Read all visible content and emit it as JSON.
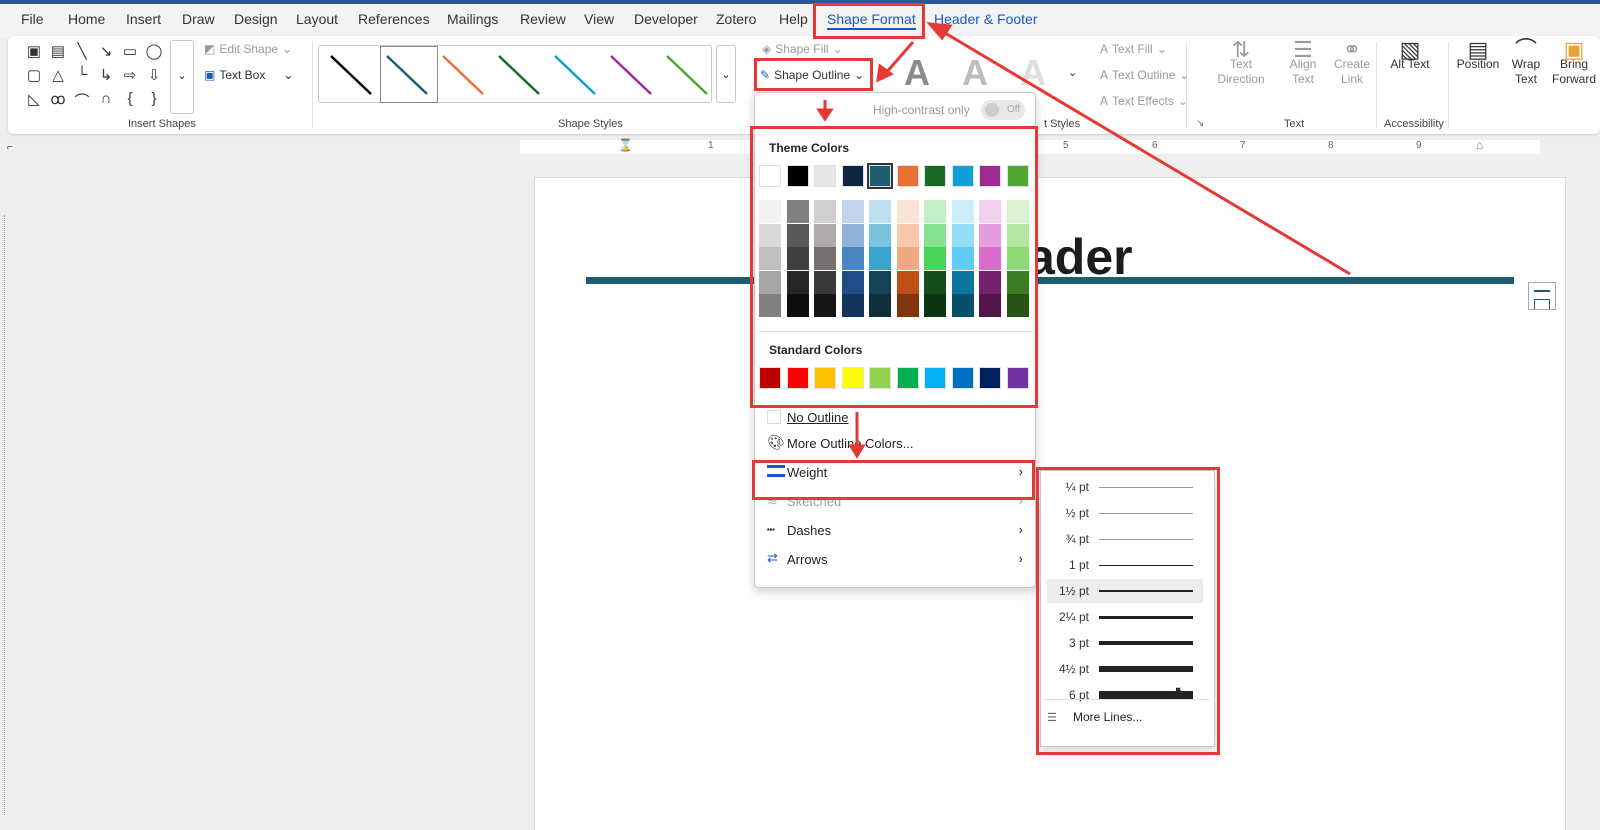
{
  "menu_tabs": [
    "File",
    "Home",
    "Insert",
    "Draw",
    "Design",
    "Layout",
    "References",
    "Mailings",
    "Review",
    "View",
    "Developer",
    "Zotero",
    "Help",
    "Shape Format",
    "Header & Footer"
  ],
  "ribbon": {
    "insert_shapes": {
      "label": "Insert Shapes",
      "edit_shape": "Edit Shape",
      "text_box": "Text Box"
    },
    "shape_styles": {
      "label": "Shape Styles",
      "shape_fill": "Shape Fill",
      "shape_outline": "Shape Outline"
    },
    "wordart": {
      "label": "t Styles",
      "text_fill": "Text Fill",
      "text_outline": "Text Outline",
      "text_effects": "Text Effects"
    },
    "text": {
      "label": "Text",
      "text_direction": "Text Direction",
      "align_text": "Align Text",
      "create_link": "Create Link"
    },
    "accessibility": {
      "label": "Accessibility",
      "alt_text": "Alt Text"
    },
    "arrange": {
      "position": "Position",
      "wrap_text": "Wrap Text",
      "bring_forward": "Bring Forward"
    }
  },
  "ruler_numbers": [
    "1",
    "5",
    "6",
    "7",
    "8",
    "9"
  ],
  "document": {
    "header_text": "ader"
  },
  "outline_menu": {
    "high_contrast": "High-contrast only",
    "toggle": "Off",
    "theme_colors_title": "Theme Colors",
    "standard_colors_title": "Standard Colors",
    "no_outline": "No Outline",
    "more_colors": "More Outline Colors...",
    "weight": "Weight",
    "sketched": "Sketched",
    "dashes": "Dashes",
    "arrows": "Arrows"
  },
  "theme_colors": [
    "#ffffff",
    "#000000",
    "#e7e6e6",
    "#0e2841",
    "#1d5c73",
    "#e97132",
    "#196b24",
    "#0f9ed5",
    "#a02b93",
    "#4ea72e"
  ],
  "theme_shades": [
    [
      "#f2f2f2",
      "#d9d9d9",
      "#bfbfbf",
      "#a6a6a6",
      "#808080"
    ],
    [
      "#808080",
      "#595959",
      "#404040",
      "#262626",
      "#0d0d0d"
    ],
    [
      "#d0cece",
      "#afabab",
      "#767171",
      "#3b3838",
      "#171616"
    ],
    [
      "#c1d4eb",
      "#8fb2db",
      "#4d86c4",
      "#1f4e89",
      "#15345b"
    ],
    [
      "#bde0ee",
      "#7cc2de",
      "#3aa3ce",
      "#154456",
      "#0e2e39"
    ],
    [
      "#fbe2d5",
      "#f7c7ac",
      "#f1a983",
      "#c04f15",
      "#80350e"
    ],
    [
      "#c1f0c8",
      "#84e291",
      "#47d459",
      "#124f1b",
      "#0c3512"
    ],
    [
      "#caeefb",
      "#95dcf7",
      "#61cbf3",
      "#0b769f",
      "#074f6a"
    ],
    [
      "#f2cfee",
      "#e49edd",
      "#d86dcd",
      "#77206d",
      "#4f1548"
    ],
    [
      "#daf2d0",
      "#b4e5a2",
      "#8ed973",
      "#3b7d23",
      "#275317"
    ]
  ],
  "standard_colors": [
    "#c00000",
    "#ff0000",
    "#ffc000",
    "#ffff00",
    "#92d050",
    "#00b050",
    "#00b0f0",
    "#0070c0",
    "#002060",
    "#7030a0"
  ],
  "weight_menu": {
    "items": [
      "¼ pt",
      "½ pt",
      "¾ pt",
      "1 pt",
      "1½ pt",
      "2¼ pt",
      "3 pt",
      "4½ pt",
      "6 pt"
    ],
    "weights_pt": [
      0.25,
      0.5,
      0.75,
      1,
      1.5,
      2.25,
      3,
      4.5,
      6
    ],
    "selected": "1½ pt",
    "more_lines": "More Lines..."
  },
  "gallery_line_colors": [
    "#000000",
    "#1d5c73",
    "#e97132",
    "#196b24",
    "#0f9ed5",
    "#a02b93",
    "#4ea72e"
  ],
  "colors": {
    "accent": "#185abd",
    "highlight": "#e53935"
  }
}
